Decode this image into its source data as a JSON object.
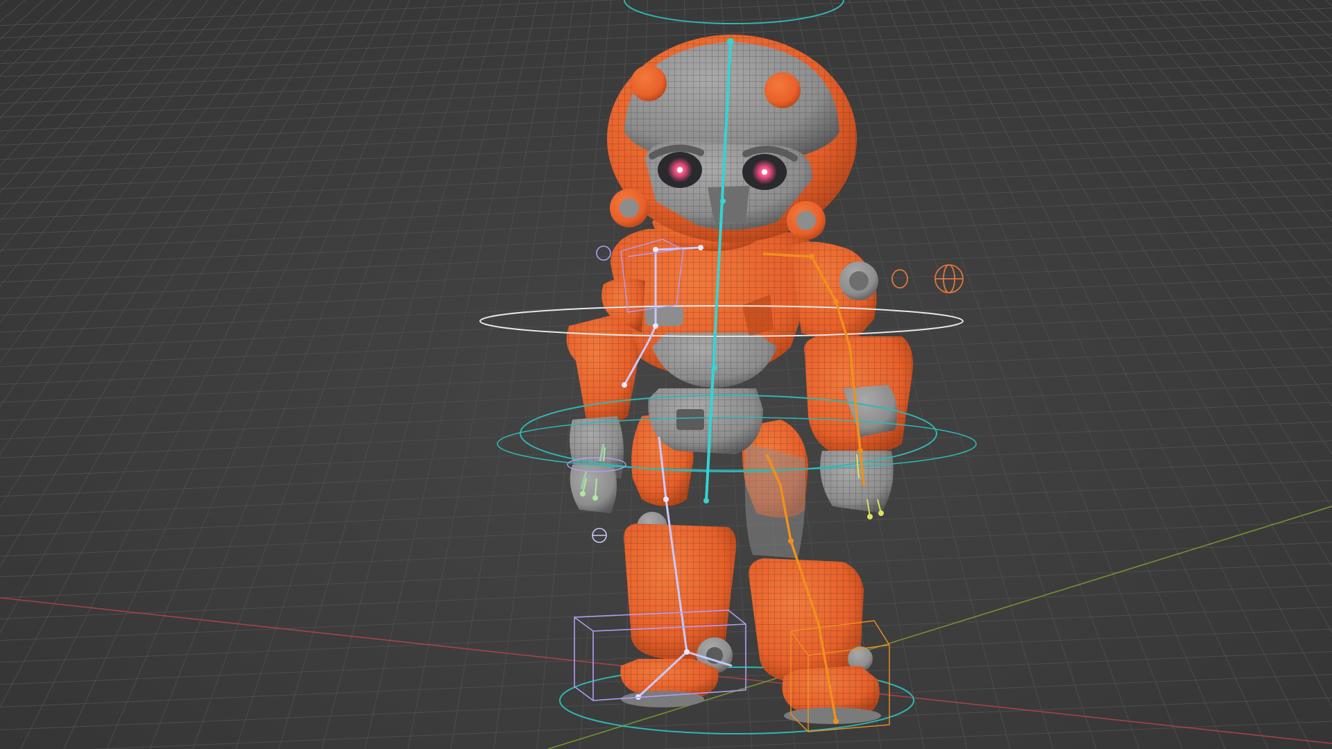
{
  "viewport": {
    "mode": "3d-viewport",
    "shading": "wireframe-overlay",
    "overlays": {
      "grid_floor": true,
      "x_axis_color": "#b8434e",
      "y_axis_color": "#7fa32d"
    }
  },
  "scene": {
    "object": "robot-character",
    "mesh_colors": {
      "armor": "#e8602a",
      "armor_shadow": "#b44418",
      "metal": "#8d8d8d",
      "metal_shadow": "#5b5b5b",
      "visor": "#2a2a2e",
      "eye_glow": "#e6487a",
      "wire": "#2b2b2b"
    },
    "rig": {
      "spine_color": "#34d4d4",
      "left_chain_color": "#c9c9ff",
      "right_chain_color": "#f0901c",
      "control_ring_color": "#2fb7b3",
      "selected_ring_color": "#e8e8e8",
      "ik_target_color": "#b39cf5"
    }
  }
}
